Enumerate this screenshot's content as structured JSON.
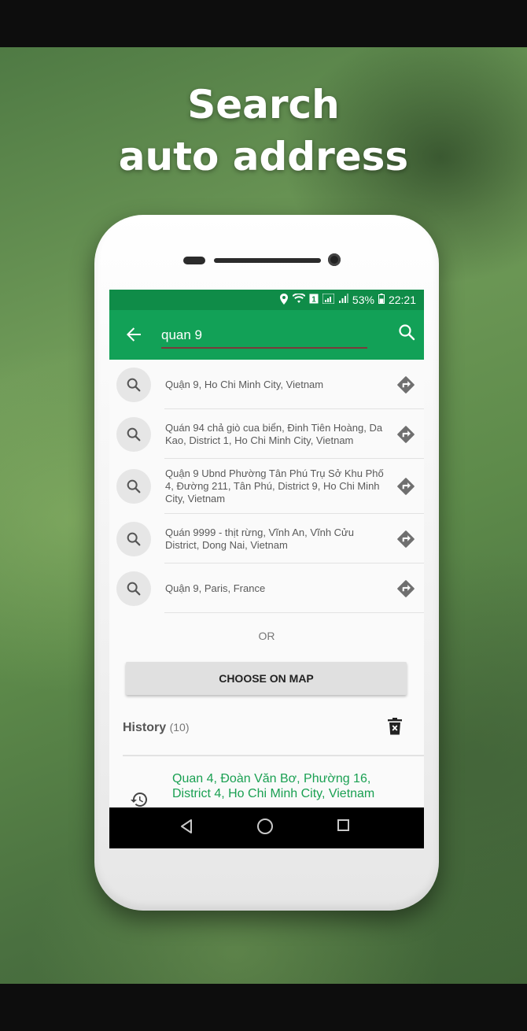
{
  "headline": {
    "line1": "Search",
    "line2": "auto address"
  },
  "status_bar": {
    "battery": "53%",
    "time": "22:21"
  },
  "search": {
    "value": "quan 9"
  },
  "results": [
    {
      "text": "Quận 9, Ho Chi Minh City, Vietnam"
    },
    {
      "text": "Quán 94 chả giò cua biển, Đinh Tiên Hoàng, Da Kao, District 1, Ho Chi Minh City, Vietnam"
    },
    {
      "text": "Quận 9 Ubnd Phường Tân Phú Trụ Sở Khu Phố 4, Đường 211, Tân Phú, District 9, Ho Chi Minh City, Vietnam"
    },
    {
      "text": "Quán 9999 - thịt rừng, Vĩnh An, Vĩnh Cửu District, Dong Nai, Vietnam"
    },
    {
      "text": "Quận 9, Paris, France"
    }
  ],
  "or_label": "OR",
  "choose_on_map": "CHOOSE ON MAP",
  "history": {
    "label": "History",
    "count": "(10)",
    "items": [
      {
        "text": "Quan 4, Đoàn Văn Bơ, Phường 16, District 4, Ho Chi Minh City, Vietnam"
      }
    ]
  },
  "colors": {
    "toolbar": "#12a157",
    "status_bar": "#0f8c48",
    "history_text": "#1aa052"
  }
}
